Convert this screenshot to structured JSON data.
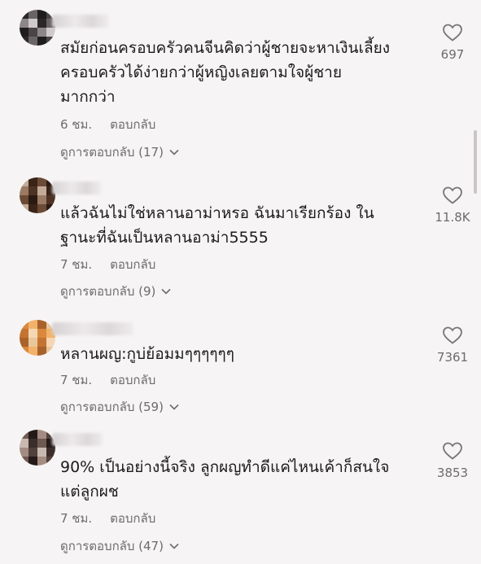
{
  "comments": [
    {
      "text": "สมัยก่อนครอบครัวคนจีนคิดว่าผู้ชายจะหาเงินเลี้ยง\nครอบครัวได้ง่ายกว่าผู้หญิงเลยตามใจผู้ชาย\nมากกว่า",
      "time": "6 ชม.",
      "reply_label": "ตอบกลับ",
      "view_replies": "ดูการตอบกลับ (17)",
      "likes": "697"
    },
    {
      "text": "แล้วฉันไม่ใช่หลานอาม่าหรอ ฉันมาเรียกร้อง ใน\nฐานะที่ฉันเป็นหลานอาม่า5555",
      "time": "7 ชม.",
      "reply_label": "ตอบกลับ",
      "view_replies": "ดูการตอบกลับ (9)",
      "likes": "11.8K"
    },
    {
      "text": "หลานผญ:กูบ่ย้อมมๆๆๆๆๆๆ",
      "time": "7 ชม.",
      "reply_label": "ตอบกลับ",
      "view_replies": "ดูการตอบกลับ (59)",
      "likes": "7361"
    },
    {
      "text": "90% เป็นอย่างนี้จริง ลูกผญทำดีแค่ไหนเค้าก็สนใจ\nแต่ลูกผช",
      "time": "7 ชม.",
      "reply_label": "ตอบกลับ",
      "view_replies": "ดูการตอบกลับ (47)",
      "likes": "3853"
    }
  ],
  "icons": {
    "like": "heart-outline-icon",
    "expand": "chevron-down-icon"
  },
  "colors": {
    "background": "#f6f4f4",
    "text": "#1b1b1b",
    "secondary": "#6c6c6c"
  }
}
